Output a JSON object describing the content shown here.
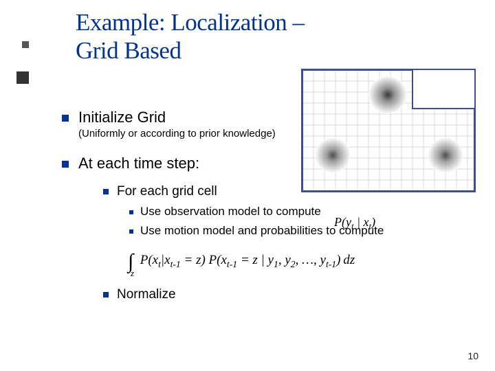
{
  "title_line1": "Example: Localization –",
  "title_line2": "Grid Based",
  "b1": "Initialize Grid",
  "b1_note": "(Uniformly or according to prior knowledge)",
  "b2": "At each time step:",
  "b2_1": "For each grid cell",
  "b2_1_1": "Use observation model to compute",
  "b2_1_2": "Use motion model and probabilities to compute",
  "b2_2": "Normalize",
  "formula1": "P(yₜ|xₜ)",
  "formula2": "∫  P(xₜ|xₜ₋₁ = z) P(xₜ₋₁ = z | y₁, y₂, …, yₜ₋₁) dz",
  "formula2_sub": "z",
  "page_number": "10"
}
